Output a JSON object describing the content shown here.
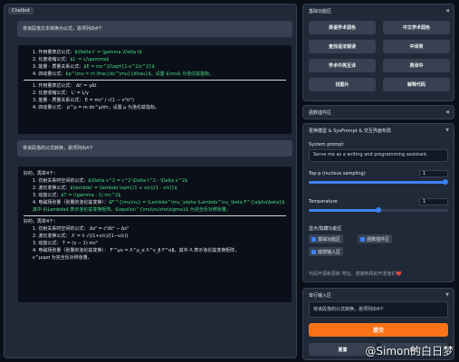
{
  "chatbot": {
    "label": "Chatbot",
    "user1": "将该段落文本转换为公式，逐项列出4个",
    "bot1_lines": [
      [
        "1. 作用量表达公式：",
        "$\\Delta t' = \\gamma \\Delta t$",
        ""
      ],
      [
        "2. 长度收缩公式：",
        "$L' = L/\\gamma$",
        ""
      ],
      [
        "3. 能量 - 质量关系公式：",
        "$E = mc^2/\\sqrt{1-v^2/c^2}$",
        ""
      ],
      [
        "4. 四动量公式：",
        "$p^\\mu = m \\frac{dx^\\mu}{d\\tau}$，设置 $\\mu$ 为洛伦兹指标。",
        ""
      ]
    ],
    "bot1_rendered": [
      "1. 作用量表达公式： Δt' = γΔt",
      "2. 长度收缩公式： L' = L/γ",
      "3. 能量 - 质量关系公式： E = mc² / √(1 − v²/c²)",
      "4. 四动量公式： p^μ = m dx^μ/dτ，设置 μ 为洛伦兹指标。"
    ],
    "user2": "将该段落的公式转换，逐项列出4个",
    "bot2_intro": "好的，再举4个：",
    "bot2_lines": [
      [
        "1. 仿射关系时空间的公式：",
        "$\\Delta s^2 = c^2 \\Delta t^2 - \\Delta x^2$",
        ""
      ],
      [
        "2. 波长变换公式：",
        "$\\lambda' = \\lambda \\sqrt{(1 + v/c)/(1 - v/c)}$",
        ""
      ],
      [
        "3. 动能公式：",
        "$T = (\\gamma - 1) mc^2$",
        ""
      ],
      [
        "4. 电磁场张量（张量的洛伦兹变换）：",
        "$F'^{\\mu\\nu} = \\Lambda^\\mu_\\alpha \\Lambda^\\nu_\\beta F^{\\alpha\\beta}$",
        ""
      ]
    ],
    "bot2_tail": "其中 $\\Lambda$ 表示洛伦兹变换矩阵，$\\epsilon^{\\mu\\nu\\rho\\sigma}$ 为完全反对称张量。",
    "bot2_rendered_intro": "好的，再举4个：",
    "bot2_rendered": [
      "1. 仿射关系时空间的公式： Δs² = c²Δt² − Δx²",
      "2. 波长变换公式： λ' = λ √((1+v/c)/(1−v/c))",
      "3. 动能公式： T = (γ − 1) mc²",
      "4. 电磁场张量（张量的洛伦兹变换）： F'^μν = Λ^μ_α Λ^ν_β F^αβ，其中 Λ 表示洛伦兹变换矩阵，",
      "ε^μνρσ 为完全反对称张量。"
    ]
  },
  "functions": {
    "title": "基础功能区",
    "buttons": [
      "英语学术润色",
      "中文学术润色",
      "查找语法错误",
      "中译英",
      "学术中英互译",
      "英译中",
      "找图片",
      "解释代码"
    ]
  },
  "fn_plugins": {
    "title": "函数插件区"
  },
  "settings": {
    "title": "更换模型 & SysPrompt & 交互界面布局",
    "sys_prompt_label": "System prompt",
    "sys_prompt_value": "Serve me as a writing and programming assistant.",
    "top_p_label": "Top-p (nucleus sampling)",
    "top_p_value": "1",
    "top_p_fraction": 0.98,
    "temperature_label": "Temperature",
    "temperature_value": "1",
    "temperature_fraction": 0.5,
    "checkbox_title": "显示/隐藏功能区",
    "checkboxes": [
      "基础功能区",
      "函数插件区",
      "底部输入区"
    ],
    "footer": "代码开源和更新 地址，感谢热情的开发者们❤️"
  },
  "input": {
    "title": "单行输入区",
    "value": "将该段落的公式转换，逐项列出4个",
    "submit": "提交",
    "reset": "重置",
    "stop": "停止"
  },
  "watermark": "@Simon的白日梦",
  "colors": {
    "accent": "#f97316",
    "slider": "#3b82f6",
    "latex_green": "#4ade80",
    "latex_magenta": "#e879f9"
  }
}
